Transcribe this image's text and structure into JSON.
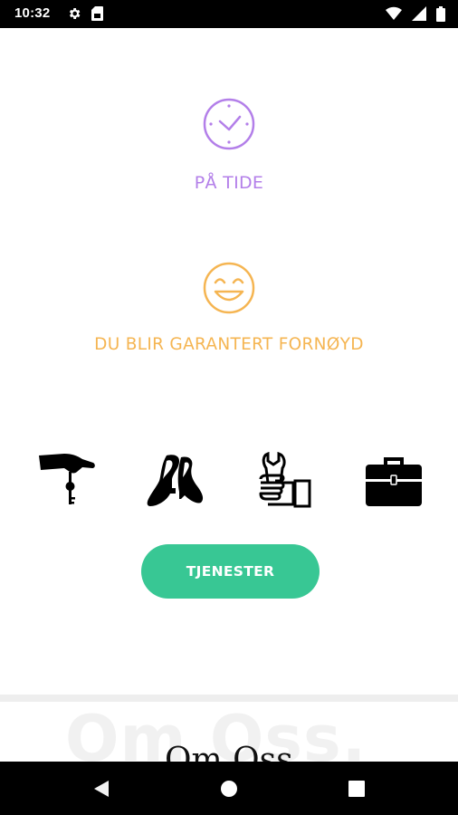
{
  "status_bar": {
    "time": "10:32",
    "left_icons": [
      "gear-icon",
      "sim-card-icon"
    ],
    "right_icons": [
      "wifi-icon",
      "signal-icon",
      "battery-icon"
    ]
  },
  "features": [
    {
      "title": "PÅ TIDE",
      "icon": "clock-icon",
      "color": "#b37fe9"
    },
    {
      "title": "DU BLIR GARANTERT FORNØYD",
      "icon": "smiley-icon",
      "color": "#f5b552"
    }
  ],
  "service_icons": [
    "hand-with-keys-icon",
    "shoes-icon",
    "fist-with-wrench-icon",
    "briefcase-icon"
  ],
  "services_button": {
    "label": "TJENESTER",
    "color": "#38c794"
  },
  "about": {
    "watermark": "Om Oss.",
    "title": "Om Oss"
  },
  "nav_bar": [
    "back-icon",
    "home-icon",
    "recents-icon"
  ]
}
